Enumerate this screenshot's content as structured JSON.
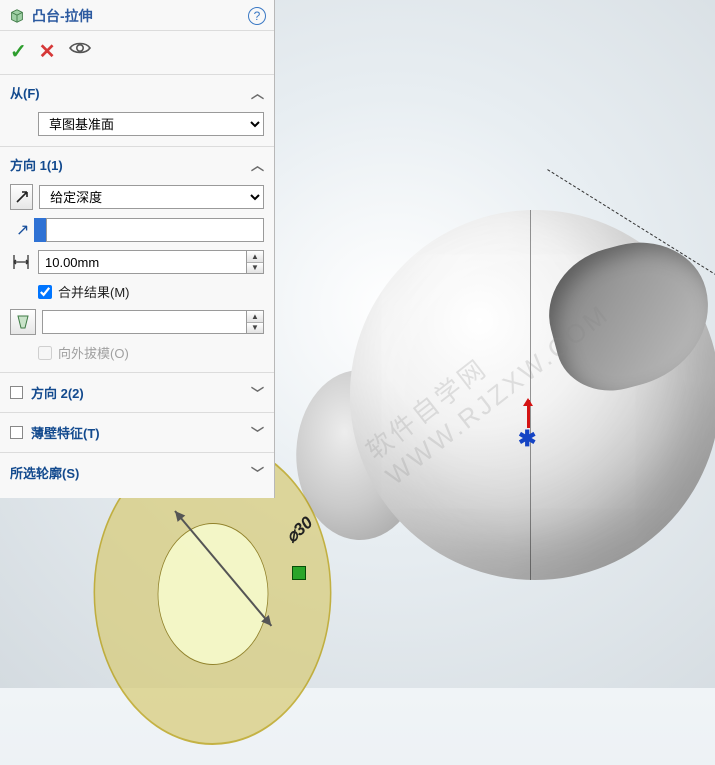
{
  "panel": {
    "title": "凸台-拉伸",
    "help": "?",
    "ok": "✓",
    "cancel": "✕"
  },
  "from": {
    "label": "从(F)",
    "start_condition": "草图基准面"
  },
  "dir1": {
    "label": "方向 1(1)",
    "end_condition": "给定深度",
    "depth": "10.00mm",
    "merge_checked": true,
    "merge_label": "合并结果(M)",
    "draft_checked": false,
    "draft_label": "向外拔模(O)"
  },
  "dir2": {
    "label": "方向 2(2)"
  },
  "thin": {
    "label": "薄壁特征(T)"
  },
  "contours": {
    "label": "所选轮廓(S)"
  },
  "viewport": {
    "dimension_label": "⌀30"
  },
  "watermark": "软件自学网 WWW.RJZXW.COM"
}
